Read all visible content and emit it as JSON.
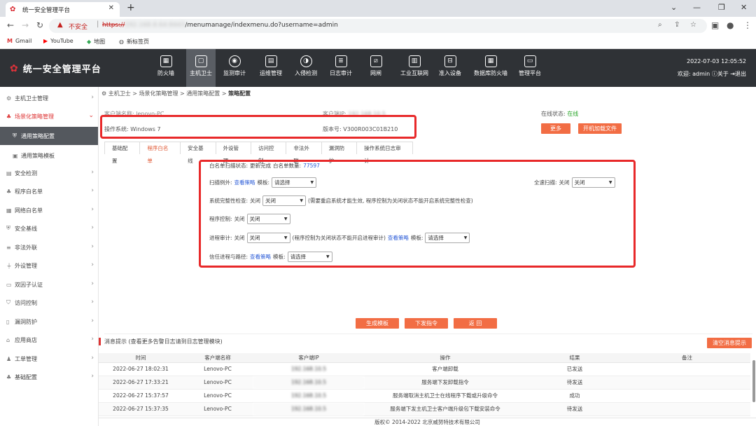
{
  "browser": {
    "tab_title": "统一安全管理平台",
    "insecure_label": "不安全",
    "url_scheme": "https://",
    "url_host_blurred": "192.168.8.64:8443",
    "url_path": "/menumanage/indexmenu.do?username=admin",
    "bookmarks": [
      "Gmail",
      "YouTube",
      "地图",
      "新标签页"
    ]
  },
  "header": {
    "title": "统一安全管理平台",
    "nav": [
      {
        "label": "防火墙",
        "icon": "firewall-icon"
      },
      {
        "label": "主机卫士",
        "icon": "host-guard-icon"
      },
      {
        "label": "监测审计",
        "icon": "monitor-icon"
      },
      {
        "label": "运维管理",
        "icon": "ops-icon"
      },
      {
        "label": "入侵检测",
        "icon": "intrusion-icon"
      },
      {
        "label": "日志审计",
        "icon": "log-icon"
      },
      {
        "label": "网闸",
        "icon": "gateway-icon"
      },
      {
        "label": "工业互联网",
        "icon": "industrial-icon"
      },
      {
        "label": "准入设备",
        "icon": "access-icon"
      },
      {
        "label": "数据库防火墙",
        "icon": "db-firewall-icon"
      },
      {
        "label": "管理平台",
        "icon": "platform-icon"
      }
    ],
    "datetime": "2022-07-03 12:05:52",
    "welcome": "欢迎: admin",
    "about": "关于",
    "logout": "退出"
  },
  "sidebar": {
    "items": [
      {
        "label": "主机卫士管理"
      },
      {
        "label": "场景化策略管理"
      },
      {
        "label": "通用策略配置"
      },
      {
        "label": "通用策略模板"
      },
      {
        "label": "安全检测"
      },
      {
        "label": "程序白名单"
      },
      {
        "label": "网络白名单"
      },
      {
        "label": "安全基线"
      },
      {
        "label": "非法外联"
      },
      {
        "label": "外设管理"
      },
      {
        "label": "双因子认证"
      },
      {
        "label": "访问控制"
      },
      {
        "label": "漏洞防护"
      },
      {
        "label": "应用商店"
      },
      {
        "label": "工单管理"
      },
      {
        "label": "基础配置"
      }
    ]
  },
  "breadcrumb": {
    "path": "主机卫士 > 场景化策略管理 > 通用策略配置 > ",
    "current": "策略配置"
  },
  "client_info": {
    "name_label": "客户端名称: ",
    "name_value": "lenovo-PC",
    "ip_label": "客户端IP: ",
    "ip_value": "192.168.10.5",
    "status_label": "在线状态: ",
    "status_value": "在线",
    "os_label": "操作系统: ",
    "os_value": "Windows 7",
    "version_label": "版本号: ",
    "version_value": "V300R003C01B210",
    "more_button": "更多",
    "boot_file_button": "开机加载文件"
  },
  "config_tabs": [
    "基础配置",
    "程序白名单",
    "安全基线",
    "外设管理",
    "访问控制",
    "非法外联",
    "漏洞防护",
    "操作系统日志审计"
  ],
  "whitelist": {
    "scan_status_label": "白名单扫描状态: ",
    "scan_status_value": "更新完成",
    "count_label": "白名单数量: ",
    "count_value": "77597",
    "scan_exception_label": "扫描例外: ",
    "view_policy": "查看策略",
    "template_label": "模板: ",
    "select_placeholder": "请选择",
    "full_scan_label": "全速扫描: ",
    "off_label": "关闭",
    "integrity_label": "系统完整性检查: ",
    "integrity_note": "(需要重启系统才能生效, 程序控制为关闭状态不能开启系统完整性检查)",
    "program_control_label": "程序控制: ",
    "process_audit_label": "进程审计: ",
    "process_audit_note": "(程序控制为关闭状态不能开启进程审计)",
    "trusted_label": "信任进程与路径: "
  },
  "actions": {
    "generate_template": "生成模板",
    "send_command": "下发指令",
    "back": "返 回"
  },
  "messages": {
    "title": "消息提示 (查看更多告警日志请到日志管理模块)",
    "clear_button": "清空消息提示",
    "columns": [
      "时间",
      "客户端名称",
      "客户端IP",
      "操作",
      "结果",
      "备注"
    ],
    "rows": [
      {
        "time": "2022-06-27 18:02:31",
        "name": "Lenovo-PC",
        "ip": "192.168.10.5",
        "op": "客户端卸载",
        "result": "已发送",
        "note": ""
      },
      {
        "time": "2022-06-27 17:33:21",
        "name": "Lenovo-PC",
        "ip": "192.168.10.5",
        "op": "服务端下发卸载指令",
        "result": "待发送",
        "note": ""
      },
      {
        "time": "2022-06-27 15:37:57",
        "name": "Lenovo-PC",
        "ip": "192.168.10.5",
        "op": "服务端取消主机卫士在线程序下载或升级命令",
        "result": "成功",
        "note": ""
      },
      {
        "time": "2022-06-27 15:37:35",
        "name": "Lenovo-PC",
        "ip": "192.168.10.5",
        "op": "服务端下发主机卫士客户端升级包下载安装命令",
        "result": "待发送",
        "note": ""
      }
    ]
  },
  "footer": "版权© 2014-2022 北京威努特技术有限公司",
  "colors": {
    "accent": "#f26d44",
    "header_bg": "#2f3236",
    "highlight_box": "#e8292a"
  }
}
